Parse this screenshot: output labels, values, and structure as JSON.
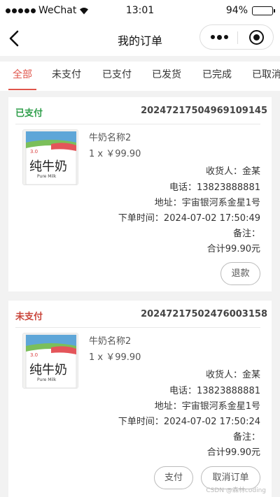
{
  "status_bar": {
    "carrier": "WeChat",
    "time": "13:01",
    "battery": "94%"
  },
  "nav": {
    "title": "我的订单"
  },
  "tabs": [
    {
      "label": "全部",
      "active": true
    },
    {
      "label": "未支付",
      "active": false
    },
    {
      "label": "已支付",
      "active": false
    },
    {
      "label": "已发货",
      "active": false
    },
    {
      "label": "已完成",
      "active": false
    },
    {
      "label": "已取消",
      "active": false
    }
  ],
  "orders": [
    {
      "status": "已支付",
      "status_color": "#2e9e4a",
      "order_no": "20247217504969109145",
      "product_name": "牛奶名称2",
      "quantity_price": "1 x ￥99.90",
      "receiver": "收货人：金某",
      "phone": "电话：13823888881",
      "address": "地址：宇宙银河系金星1号",
      "order_time": "下单时间：2024-07-02 17:50:49",
      "remark": "备注：",
      "total": "合计99.90元",
      "buttons": [
        "退款"
      ]
    },
    {
      "status": "未支付",
      "status_color": "#c9453a",
      "order_no": "20247217502476003158",
      "product_name": "牛奶名称2",
      "quantity_price": "1 x ￥99.90",
      "receiver": "收货人：金某",
      "phone": "电话：13823888881",
      "address": "地址：宇宙银河系金星1号",
      "order_time": "下单时间：2024-07-02 17:50:24",
      "remark": "备注：",
      "total": "合计99.90元",
      "buttons": [
        "支付",
        "取消订单"
      ]
    }
  ],
  "product_image": {
    "brand_text": "纯牛奶",
    "sub_text": "Pure Milk"
  },
  "watermark": "CSDN @森林coding",
  "colors": {
    "accent": "#e0554b",
    "paid": "#2e9e4a",
    "unpaid": "#c9453a"
  }
}
